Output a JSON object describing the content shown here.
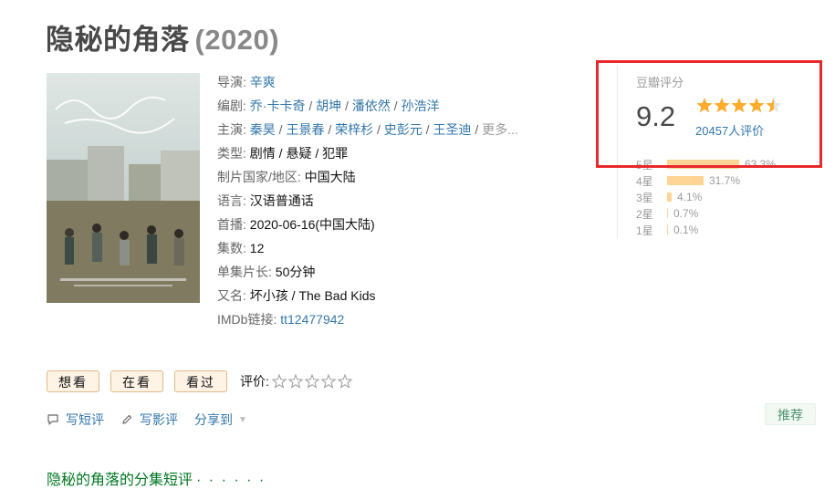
{
  "title": {
    "name": "隐秘的角落",
    "year": "(2020)"
  },
  "info": {
    "director": {
      "label": "导演:",
      "names": [
        "辛爽"
      ]
    },
    "writers": {
      "label": "编剧:",
      "names": [
        "乔·卡卡奇",
        "胡坤",
        "潘依然",
        "孙浩洋"
      ]
    },
    "cast": {
      "label": "主演:",
      "names": [
        "秦昊",
        "王景春",
        "荣梓杉",
        "史彭元",
        "王圣迪"
      ],
      "more": "更多..."
    },
    "genre": {
      "label": "类型:",
      "values": [
        "剧情",
        "悬疑",
        "犯罪"
      ]
    },
    "country": {
      "label": "制片国家/地区:",
      "value": "中国大陆"
    },
    "language": {
      "label": "语言:",
      "value": "汉语普通话"
    },
    "premiere": {
      "label": "首播:",
      "value": "2020-06-16(中国大陆)"
    },
    "episodes": {
      "label": "集数:",
      "value": "12"
    },
    "runtime": {
      "label": "单集片长:",
      "value": "50分钟"
    },
    "aka": {
      "label": "又名:",
      "value": "坏小孩 / The Bad Kids"
    },
    "imdb": {
      "label": "IMDb链接:",
      "value": "tt12477942"
    }
  },
  "rating": {
    "title": "豆瓣评分",
    "score": "9.2",
    "stars": 4.5,
    "votes": "20457人评价",
    "distribution": [
      {
        "label": "5星",
        "percent": 63.3,
        "text": "63.3%"
      },
      {
        "label": "4星",
        "percent": 31.7,
        "text": "31.7%"
      },
      {
        "label": "3星",
        "percent": 4.1,
        "text": "4.1%"
      },
      {
        "label": "2星",
        "percent": 0.7,
        "text": "0.7%"
      },
      {
        "label": "1星",
        "percent": 0.1,
        "text": "0.1%"
      }
    ]
  },
  "actions": {
    "want": "想看",
    "watching": "在看",
    "watched": "看过",
    "rate_label": "评价:"
  },
  "links": {
    "short_review": "写短评",
    "review": "写影评",
    "share": "分享到",
    "recommend": "推荐"
  },
  "section": {
    "episode_reviews": "隐秘的角落的分集短评",
    "dots": "· · · · · ·"
  },
  "colors": {
    "link": "#37a",
    "star": "#ffac2d",
    "bar": "#ffd596",
    "highlight": "#e8282b",
    "section": "#072"
  }
}
